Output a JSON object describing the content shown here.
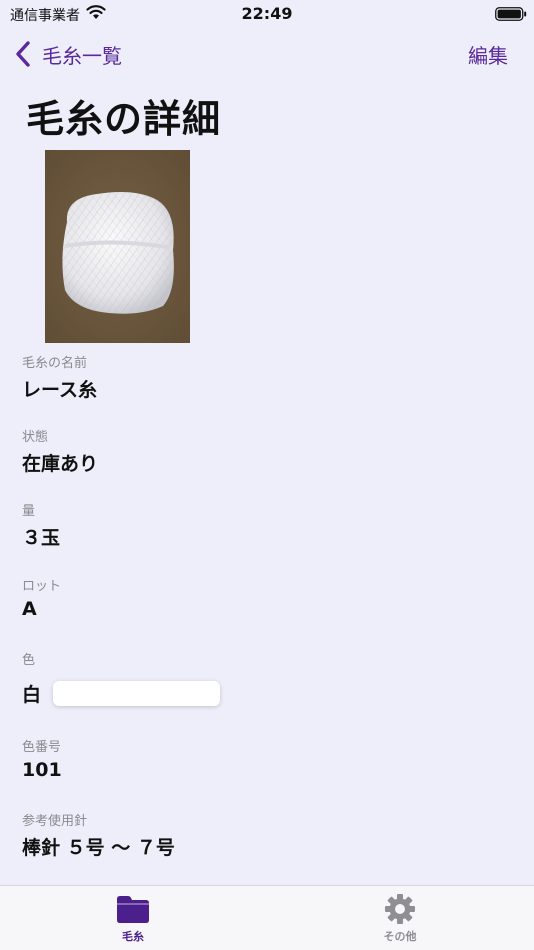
{
  "status_bar": {
    "carrier": "通信事業者",
    "time": "22:49"
  },
  "nav": {
    "back_label": "毛糸一覧",
    "edit_label": "編集",
    "accent_color": "#5a2a9c"
  },
  "page": {
    "title": "毛糸の詳細"
  },
  "fields": [
    {
      "label": "毛糸の名前",
      "value": "レース糸"
    },
    {
      "label": "状態",
      "value": "在庫あり"
    },
    {
      "label": "量",
      "value": "３玉"
    },
    {
      "label": "ロット",
      "value": "A"
    },
    {
      "label": "色",
      "value": "白"
    },
    {
      "label": "色番号",
      "value": "101"
    },
    {
      "label": "参考使用針",
      "value": "棒針 ５号 〜 ７号"
    }
  ],
  "color_swatch": "#ffffff",
  "tab_bar": {
    "tabs": [
      {
        "label": "毛糸",
        "icon": "folder-icon",
        "selected": true
      },
      {
        "label": "その他",
        "icon": "gear-icon",
        "selected": false
      }
    ]
  }
}
